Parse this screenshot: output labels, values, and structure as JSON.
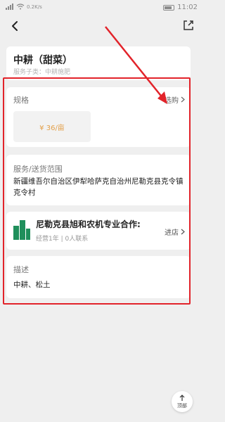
{
  "status_bar": {
    "left_icons": [
      "sim-signal-icon",
      "wifi-icon"
    ],
    "battery": "battery-icon",
    "time": "11:02",
    "data_speed": "0.2K/s"
  },
  "nav": {
    "back_icon": "back-arrow-icon",
    "share_icon": "share-icon"
  },
  "product": {
    "title": "中耕（甜菜）",
    "service_type": "服务子类：中耕施肥"
  },
  "spec": {
    "label": "规格",
    "select_label": "选购",
    "price": "¥ 36/亩"
  },
  "service_area": {
    "label": "服务/送货范围",
    "text": "新疆维吾尔自治区伊犁哈萨克自治州尼勒克县克令镇克令村"
  },
  "shop": {
    "name": "尼勒克县旭和农机专业合作:",
    "meta": "经营1年 | 0人联系",
    "enter_label": "进店",
    "logo_icon": "building-logo-icon"
  },
  "description": {
    "label": "描述",
    "text": "中耕、松土"
  },
  "scroll_top": {
    "label": "顶部"
  },
  "colors": {
    "accent_price": "#e3a04a",
    "annotation": "#e2232a",
    "logo_green": "#1f8f5b"
  }
}
